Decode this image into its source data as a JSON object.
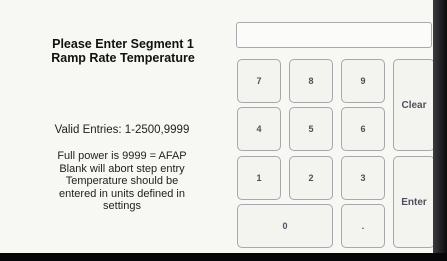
{
  "prompt": {
    "title_line1": "Please Enter Segment 1",
    "title_line2": "Ramp Rate Temperature",
    "valid_entries": "Valid Entries: 1-2500,9999",
    "info_lines": [
      "Full power is 9999 = AFAP",
      "Blank will abort step entry",
      "Temperature should be",
      "entered in units defined in",
      "settings"
    ]
  },
  "entry": {
    "value": ""
  },
  "keypad": {
    "k7": "7",
    "k8": "8",
    "k9": "9",
    "k4": "4",
    "k5": "5",
    "k6": "6",
    "k1": "1",
    "k2": "2",
    "k3": "3",
    "k0": "0",
    "dot": ".",
    "clear": "Clear",
    "enter": "Enter"
  }
}
